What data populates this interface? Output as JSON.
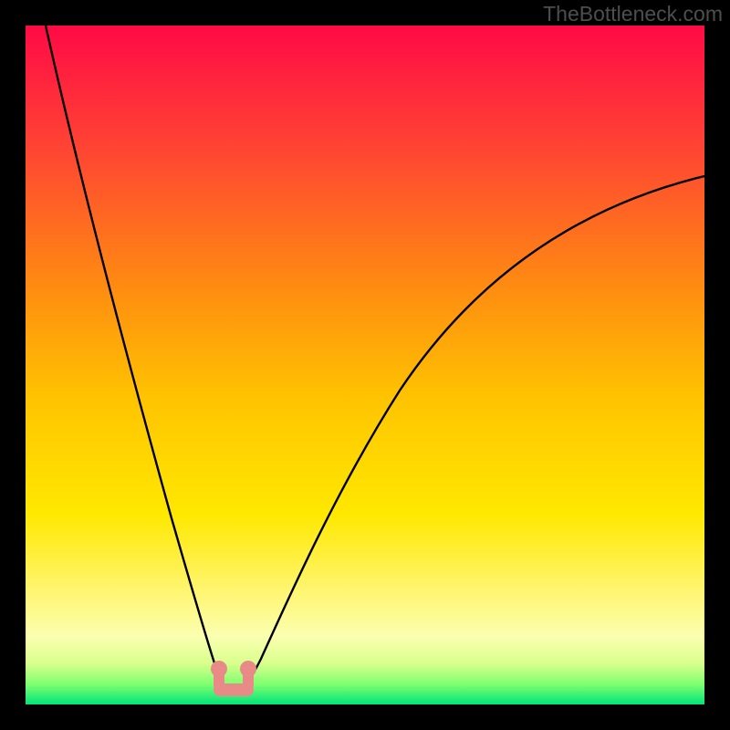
{
  "watermark": "TheBottleneck.com",
  "chart_data": {
    "type": "line",
    "title": "",
    "xlabel": "",
    "ylabel": "",
    "xlim": [
      0,
      1
    ],
    "ylim": [
      0,
      1
    ],
    "background_gradient": [
      {
        "y": 1.0,
        "color": "#ff0a46"
      },
      {
        "y": 0.75,
        "color": "#ff5a2f"
      },
      {
        "y": 0.5,
        "color": "#ffb400"
      },
      {
        "y": 0.3,
        "color": "#ffe600"
      },
      {
        "y": 0.18,
        "color": "#fff56e"
      },
      {
        "y": 0.12,
        "color": "#fdffa8"
      },
      {
        "y": 0.06,
        "color": "#dcff7e"
      },
      {
        "y": 0.03,
        "color": "#7dff6a"
      },
      {
        "y": 0.0,
        "color": "#00e47a"
      }
    ],
    "curve": {
      "description": "V-shaped bottleneck curve; left branch steep, right branch shallower; minimum near x≈0.30 at y≈0",
      "x": [
        0.03,
        0.08,
        0.13,
        0.18,
        0.22,
        0.26,
        0.285,
        0.3,
        0.315,
        0.35,
        0.4,
        0.48,
        0.58,
        0.7,
        0.82,
        0.92,
        1.0
      ],
      "y": [
        1.0,
        0.8,
        0.6,
        0.4,
        0.25,
        0.12,
        0.035,
        0.02,
        0.035,
        0.12,
        0.26,
        0.44,
        0.58,
        0.68,
        0.74,
        0.77,
        0.78
      ]
    },
    "bottom_marker": {
      "description": "pink rounded U marker at curve minimum",
      "color": "#e88b88",
      "cx": 0.3,
      "cy": 0.03,
      "halfwidth": 0.022,
      "height": 0.034,
      "dot_radius": 0.012
    }
  }
}
